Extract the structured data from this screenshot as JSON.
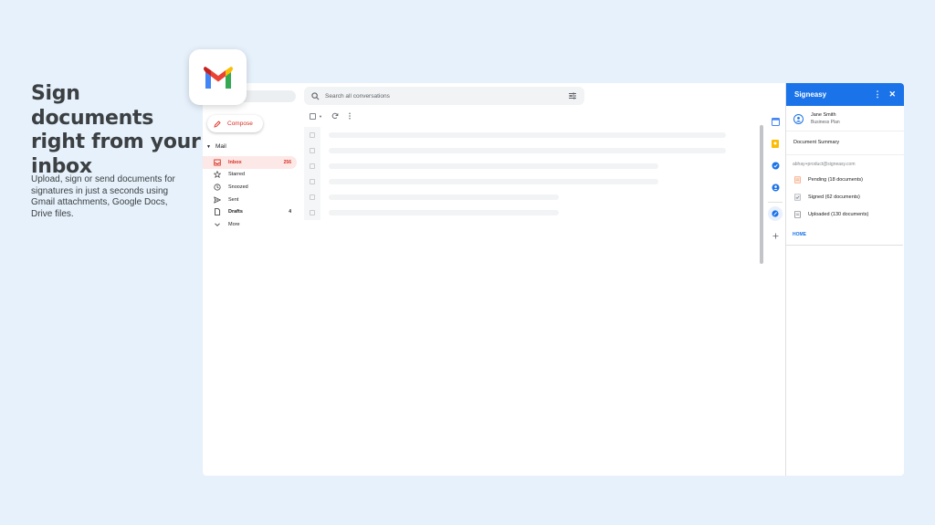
{
  "headline": "Sign documents right from your inbox",
  "subtext": "Upload, sign or send documents for signatures in just a seconds using Gmail attachments, Google Docs, Drive files.",
  "colors": {
    "background": "#e6f1fb",
    "accent": "#1a73e8",
    "gmail_red": "#d93025"
  },
  "gmail": {
    "search_placeholder": "Search all conversations",
    "compose_label": "Compose",
    "mail_label": "Mail",
    "nav": [
      {
        "label": "Inbox",
        "count": "256",
        "icon": "inbox-icon"
      },
      {
        "label": "Starred",
        "count": "",
        "icon": "star-icon"
      },
      {
        "label": "Snoozed",
        "count": "",
        "icon": "clock-icon"
      },
      {
        "label": "Sent",
        "count": "",
        "icon": "send-icon"
      },
      {
        "label": "Drafts",
        "count": "4",
        "icon": "draft-icon"
      },
      {
        "label": "More",
        "count": "",
        "icon": "chevron-down-icon"
      }
    ]
  },
  "signeasy": {
    "title": "Signeasy",
    "user_name": "Jane Smith",
    "user_plan": "Business Plan",
    "summary_label": "Document Summary",
    "email": "abhay+product@signeasy.com",
    "docs": [
      {
        "label": "Pending (18 documents)",
        "icon": "pending-doc-icon"
      },
      {
        "label": "Signed (62 documents)",
        "icon": "signed-doc-icon"
      },
      {
        "label": "Uploaded (130 documents)",
        "icon": "uploaded-doc-icon"
      }
    ],
    "home_label": "HOME"
  }
}
